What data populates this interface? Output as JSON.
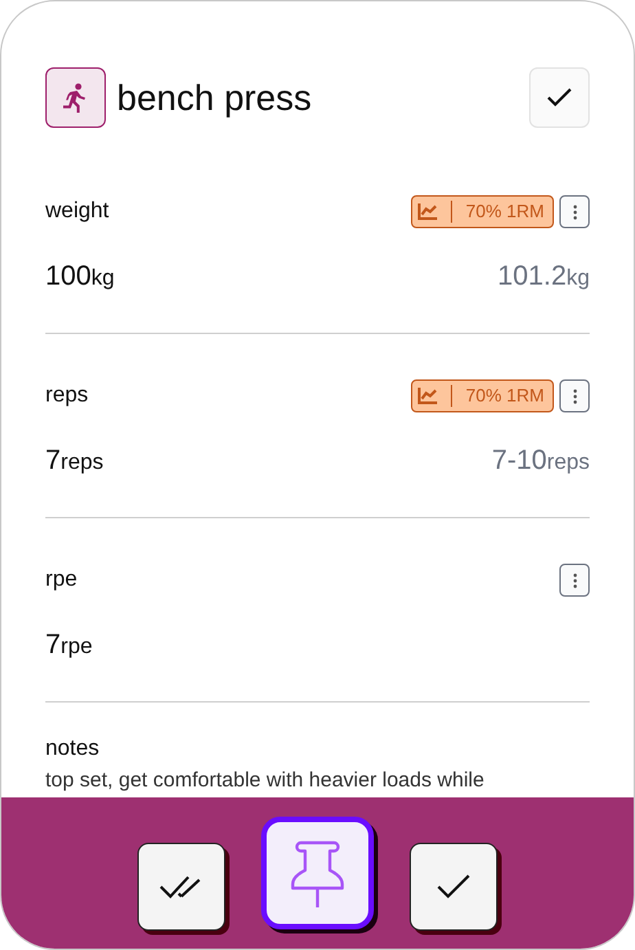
{
  "header": {
    "title": "bench press",
    "done": false
  },
  "fields": [
    {
      "label": "weight",
      "badge": "70% 1RM",
      "value": "100",
      "unit": "kg",
      "target": "101.2",
      "target_unit": "kg"
    },
    {
      "label": "reps",
      "badge": "70% 1RM",
      "value": "7",
      "unit": "reps",
      "target": "7-10",
      "target_unit": "reps"
    },
    {
      "label": "rpe",
      "value": "7",
      "unit": "rpe"
    }
  ],
  "notes": {
    "label": "notes",
    "text": "top set, get comfortable with heavier loads while"
  },
  "actions": [
    {
      "kind": "complete-all",
      "selected": false
    },
    {
      "kind": "pin",
      "selected": true
    },
    {
      "kind": "complete",
      "selected": false
    }
  ]
}
